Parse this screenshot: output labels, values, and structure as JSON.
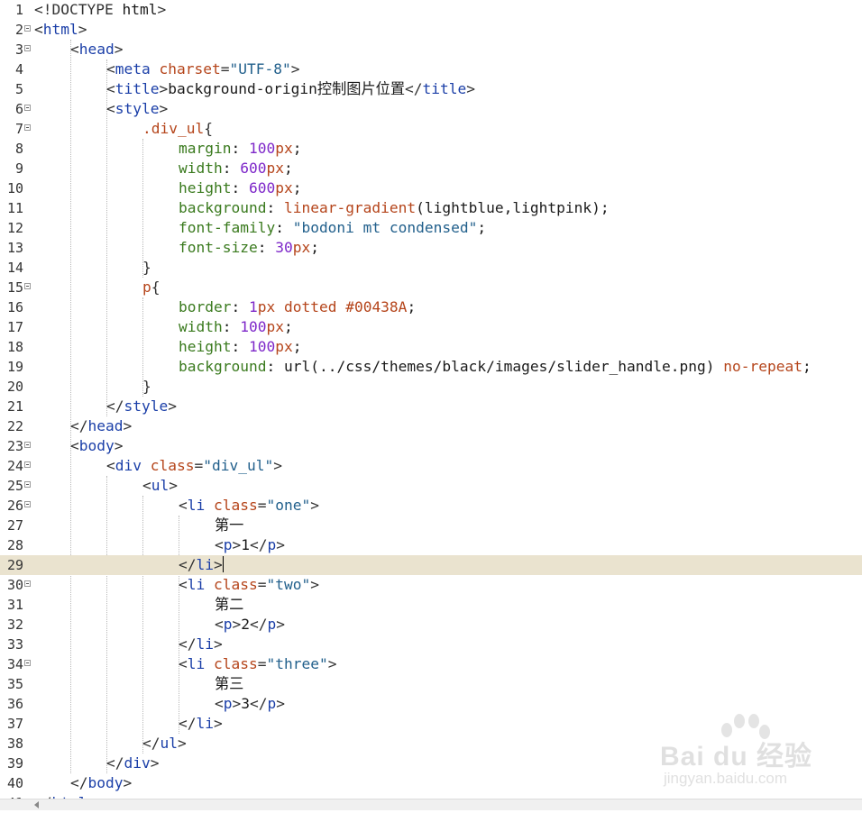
{
  "editor": {
    "current_line": 29,
    "lines": [
      {
        "n": "1",
        "fold": false,
        "indent": 0,
        "tokens": [
          [
            "t-bracket",
            "<!DOCTYPE "
          ],
          [
            "t-plain",
            "html"
          ],
          [
            "t-bracket",
            ">"
          ]
        ]
      },
      {
        "n": "2",
        "fold": true,
        "indent": 0,
        "tokens": [
          [
            "t-bracket",
            "<"
          ],
          [
            "t-tag",
            "html"
          ],
          [
            "t-bracket",
            ">"
          ]
        ]
      },
      {
        "n": "3",
        "fold": true,
        "indent": 1,
        "tokens": [
          [
            "t-bracket",
            "<"
          ],
          [
            "t-tag",
            "head"
          ],
          [
            "t-bracket",
            ">"
          ]
        ]
      },
      {
        "n": "4",
        "fold": false,
        "indent": 2,
        "tokens": [
          [
            "t-bracket",
            "<"
          ],
          [
            "t-tag",
            "meta"
          ],
          [
            "t-plain",
            " "
          ],
          [
            "t-attr",
            "charset"
          ],
          [
            "t-bracket",
            "="
          ],
          [
            "t-str",
            "\"UTF-8\""
          ],
          [
            "t-bracket",
            ">"
          ]
        ]
      },
      {
        "n": "5",
        "fold": false,
        "indent": 2,
        "tokens": [
          [
            "t-bracket",
            "<"
          ],
          [
            "t-tag",
            "title"
          ],
          [
            "t-bracket",
            ">"
          ],
          [
            "t-plain",
            "background-origin控制图片位置"
          ],
          [
            "t-bracket",
            "</"
          ],
          [
            "t-tag",
            "title"
          ],
          [
            "t-bracket",
            ">"
          ]
        ]
      },
      {
        "n": "6",
        "fold": true,
        "indent": 2,
        "tokens": [
          [
            "t-bracket",
            "<"
          ],
          [
            "t-tag",
            "style"
          ],
          [
            "t-bracket",
            ">"
          ]
        ]
      },
      {
        "n": "7",
        "fold": true,
        "indent": 3,
        "tokens": [
          [
            "t-sel",
            ".div_ul"
          ],
          [
            "t-bracket",
            "{"
          ]
        ]
      },
      {
        "n": "8",
        "fold": false,
        "indent": 4,
        "tokens": [
          [
            "t-prop",
            "margin"
          ],
          [
            "t-plain",
            ": "
          ],
          [
            "t-num",
            "100"
          ],
          [
            "t-kw",
            "px"
          ],
          [
            "t-plain",
            ";"
          ]
        ]
      },
      {
        "n": "9",
        "fold": false,
        "indent": 4,
        "tokens": [
          [
            "t-prop",
            "width"
          ],
          [
            "t-plain",
            ": "
          ],
          [
            "t-num",
            "600"
          ],
          [
            "t-kw",
            "px"
          ],
          [
            "t-plain",
            ";"
          ]
        ]
      },
      {
        "n": "10",
        "fold": false,
        "indent": 4,
        "tokens": [
          [
            "t-prop",
            "height"
          ],
          [
            "t-plain",
            ": "
          ],
          [
            "t-num",
            "600"
          ],
          [
            "t-kw",
            "px"
          ],
          [
            "t-plain",
            ";"
          ]
        ]
      },
      {
        "n": "11",
        "fold": false,
        "indent": 4,
        "tokens": [
          [
            "t-prop",
            "background"
          ],
          [
            "t-plain",
            ": "
          ],
          [
            "t-fn",
            "linear-gradient"
          ],
          [
            "t-plain",
            "("
          ],
          [
            "t-plain",
            "lightblue,lightpink"
          ],
          [
            "t-plain",
            ");"
          ]
        ]
      },
      {
        "n": "12",
        "fold": false,
        "indent": 4,
        "tokens": [
          [
            "t-prop",
            "font-family"
          ],
          [
            "t-plain",
            ": "
          ],
          [
            "t-str",
            "\"bodoni mt condensed\""
          ],
          [
            "t-plain",
            ";"
          ]
        ]
      },
      {
        "n": "13",
        "fold": false,
        "indent": 4,
        "tokens": [
          [
            "t-prop",
            "font-size"
          ],
          [
            "t-plain",
            ": "
          ],
          [
            "t-num",
            "30"
          ],
          [
            "t-kw",
            "px"
          ],
          [
            "t-plain",
            ";"
          ]
        ]
      },
      {
        "n": "14",
        "fold": false,
        "indent": 3,
        "tokens": [
          [
            "t-bracket",
            "}"
          ]
        ]
      },
      {
        "n": "15",
        "fold": true,
        "indent": 3,
        "tokens": [
          [
            "t-sel",
            "p"
          ],
          [
            "t-bracket",
            "{"
          ]
        ]
      },
      {
        "n": "16",
        "fold": false,
        "indent": 4,
        "tokens": [
          [
            "t-prop",
            "border"
          ],
          [
            "t-plain",
            ": "
          ],
          [
            "t-num",
            "1"
          ],
          [
            "t-kw",
            "px dotted "
          ],
          [
            "t-hex",
            "#00438A"
          ],
          [
            "t-plain",
            ";"
          ]
        ]
      },
      {
        "n": "17",
        "fold": false,
        "indent": 4,
        "tokens": [
          [
            "t-prop",
            "width"
          ],
          [
            "t-plain",
            ": "
          ],
          [
            "t-num",
            "100"
          ],
          [
            "t-kw",
            "px"
          ],
          [
            "t-plain",
            ";"
          ]
        ]
      },
      {
        "n": "18",
        "fold": false,
        "indent": 4,
        "tokens": [
          [
            "t-prop",
            "height"
          ],
          [
            "t-plain",
            ": "
          ],
          [
            "t-num",
            "100"
          ],
          [
            "t-kw",
            "px"
          ],
          [
            "t-plain",
            ";"
          ]
        ]
      },
      {
        "n": "19",
        "fold": false,
        "indent": 4,
        "tokens": [
          [
            "t-prop",
            "background"
          ],
          [
            "t-plain",
            ": "
          ],
          [
            "t-plain",
            "url(../css/themes/black/images/slider_handle.png) "
          ],
          [
            "t-kw",
            "no-repeat"
          ],
          [
            "t-plain",
            ";"
          ]
        ]
      },
      {
        "n": "20",
        "fold": false,
        "indent": 3,
        "tokens": [
          [
            "t-bracket",
            "}"
          ]
        ]
      },
      {
        "n": "21",
        "fold": false,
        "indent": 2,
        "tokens": [
          [
            "t-bracket",
            "</"
          ],
          [
            "t-tag",
            "style"
          ],
          [
            "t-bracket",
            ">"
          ]
        ]
      },
      {
        "n": "22",
        "fold": false,
        "indent": 1,
        "tokens": [
          [
            "t-bracket",
            "</"
          ],
          [
            "t-tag",
            "head"
          ],
          [
            "t-bracket",
            ">"
          ]
        ]
      },
      {
        "n": "23",
        "fold": true,
        "indent": 1,
        "tokens": [
          [
            "t-bracket",
            "<"
          ],
          [
            "t-tag",
            "body"
          ],
          [
            "t-bracket",
            ">"
          ]
        ]
      },
      {
        "n": "24",
        "fold": true,
        "indent": 2,
        "tokens": [
          [
            "t-bracket",
            "<"
          ],
          [
            "t-tag",
            "div"
          ],
          [
            "t-plain",
            " "
          ],
          [
            "t-attr",
            "class"
          ],
          [
            "t-bracket",
            "="
          ],
          [
            "t-str",
            "\"div_ul\""
          ],
          [
            "t-bracket",
            ">"
          ]
        ]
      },
      {
        "n": "25",
        "fold": true,
        "indent": 3,
        "tokens": [
          [
            "t-bracket",
            "<"
          ],
          [
            "t-tag",
            "ul"
          ],
          [
            "t-bracket",
            ">"
          ]
        ]
      },
      {
        "n": "26",
        "fold": true,
        "indent": 4,
        "tokens": [
          [
            "t-bracket",
            "<"
          ],
          [
            "t-tag",
            "li"
          ],
          [
            "t-plain",
            " "
          ],
          [
            "t-attr",
            "class"
          ],
          [
            "t-bracket",
            "="
          ],
          [
            "t-str",
            "\"one\""
          ],
          [
            "t-bracket",
            ">"
          ]
        ]
      },
      {
        "n": "27",
        "fold": false,
        "indent": 5,
        "tokens": [
          [
            "t-plain",
            "第一"
          ]
        ]
      },
      {
        "n": "28",
        "fold": false,
        "indent": 5,
        "tokens": [
          [
            "t-bracket",
            "<"
          ],
          [
            "t-tag",
            "p"
          ],
          [
            "t-bracket",
            ">"
          ],
          [
            "t-plain",
            "1"
          ],
          [
            "t-bracket",
            "</"
          ],
          [
            "t-tag",
            "p"
          ],
          [
            "t-bracket",
            ">"
          ]
        ]
      },
      {
        "n": "29",
        "fold": false,
        "indent": 4,
        "tokens": [
          [
            "t-bracket",
            "</"
          ],
          [
            "t-tag",
            "li"
          ],
          [
            "t-bracket",
            ">"
          ]
        ]
      },
      {
        "n": "30",
        "fold": true,
        "indent": 4,
        "tokens": [
          [
            "t-bracket",
            "<"
          ],
          [
            "t-tag",
            "li"
          ],
          [
            "t-plain",
            " "
          ],
          [
            "t-attr",
            "class"
          ],
          [
            "t-bracket",
            "="
          ],
          [
            "t-str",
            "\"two\""
          ],
          [
            "t-bracket",
            ">"
          ]
        ]
      },
      {
        "n": "31",
        "fold": false,
        "indent": 5,
        "tokens": [
          [
            "t-plain",
            "第二"
          ]
        ]
      },
      {
        "n": "32",
        "fold": false,
        "indent": 5,
        "tokens": [
          [
            "t-bracket",
            "<"
          ],
          [
            "t-tag",
            "p"
          ],
          [
            "t-bracket",
            ">"
          ],
          [
            "t-plain",
            "2"
          ],
          [
            "t-bracket",
            "</"
          ],
          [
            "t-tag",
            "p"
          ],
          [
            "t-bracket",
            ">"
          ]
        ]
      },
      {
        "n": "33",
        "fold": false,
        "indent": 4,
        "tokens": [
          [
            "t-bracket",
            "</"
          ],
          [
            "t-tag",
            "li"
          ],
          [
            "t-bracket",
            ">"
          ]
        ]
      },
      {
        "n": "34",
        "fold": true,
        "indent": 4,
        "tokens": [
          [
            "t-bracket",
            "<"
          ],
          [
            "t-tag",
            "li"
          ],
          [
            "t-plain",
            " "
          ],
          [
            "t-attr",
            "class"
          ],
          [
            "t-bracket",
            "="
          ],
          [
            "t-str",
            "\"three\""
          ],
          [
            "t-bracket",
            ">"
          ]
        ]
      },
      {
        "n": "35",
        "fold": false,
        "indent": 5,
        "tokens": [
          [
            "t-plain",
            "第三"
          ]
        ]
      },
      {
        "n": "36",
        "fold": false,
        "indent": 5,
        "tokens": [
          [
            "t-bracket",
            "<"
          ],
          [
            "t-tag",
            "p"
          ],
          [
            "t-bracket",
            ">"
          ],
          [
            "t-plain",
            "3"
          ],
          [
            "t-bracket",
            "</"
          ],
          [
            "t-tag",
            "p"
          ],
          [
            "t-bracket",
            ">"
          ]
        ]
      },
      {
        "n": "37",
        "fold": false,
        "indent": 4,
        "tokens": [
          [
            "t-bracket",
            "</"
          ],
          [
            "t-tag",
            "li"
          ],
          [
            "t-bracket",
            ">"
          ]
        ]
      },
      {
        "n": "38",
        "fold": false,
        "indent": 3,
        "tokens": [
          [
            "t-bracket",
            "</"
          ],
          [
            "t-tag",
            "ul"
          ],
          [
            "t-bracket",
            ">"
          ]
        ]
      },
      {
        "n": "39",
        "fold": false,
        "indent": 2,
        "tokens": [
          [
            "t-bracket",
            "</"
          ],
          [
            "t-tag",
            "div"
          ],
          [
            "t-bracket",
            ">"
          ]
        ]
      },
      {
        "n": "40",
        "fold": false,
        "indent": 1,
        "tokens": [
          [
            "t-bracket",
            "</"
          ],
          [
            "t-tag",
            "body"
          ],
          [
            "t-bracket",
            ">"
          ]
        ]
      },
      {
        "n": "41",
        "fold": false,
        "indent": 0,
        "tokens": [
          [
            "t-bracket",
            "</"
          ],
          [
            "t-tag",
            "html"
          ],
          [
            "t-bracket",
            ">"
          ]
        ]
      }
    ]
  },
  "watermark": {
    "brand": "Bai du 经验",
    "site": "jingyan.baidu.com"
  }
}
